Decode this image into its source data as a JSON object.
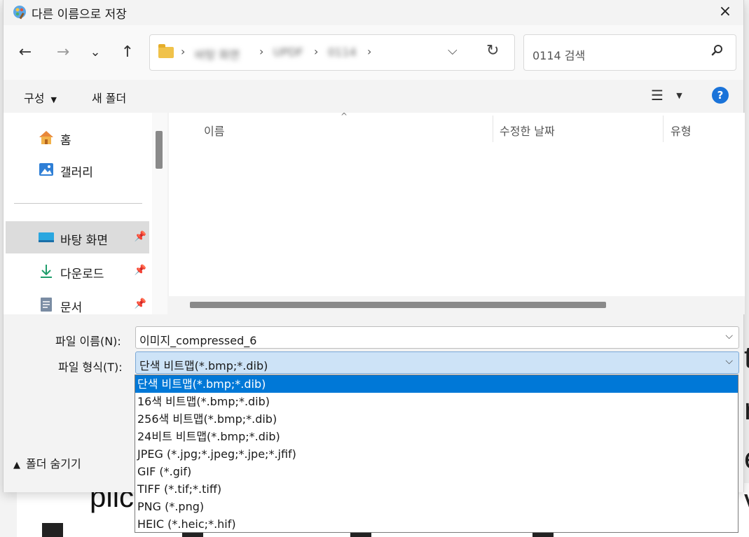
{
  "dialog": {
    "title": "다른 이름으로 저장",
    "close_icon": "×"
  },
  "nav": {
    "back": "←",
    "forward": "→",
    "recent": "⌄",
    "up": "↑"
  },
  "address": {
    "crumbs": [
      "바탕 화면",
      "UPDF",
      "0114"
    ],
    "dropdown": "⌵",
    "refresh": "↻"
  },
  "search": {
    "placeholder": "0114 검색",
    "icon": "search-icon"
  },
  "command_bar": {
    "organize_label": "구성",
    "new_folder_label": "새 폴더",
    "help_label": "?"
  },
  "sidebar": {
    "items": [
      {
        "label": "홈",
        "icon": "home-icon",
        "pinned": false
      },
      {
        "label": "갤러리",
        "icon": "gallery-icon",
        "pinned": false
      },
      {
        "label": "바탕 화면",
        "icon": "desktop-icon",
        "pinned": true,
        "selected": true
      },
      {
        "label": "다운로드",
        "icon": "download-icon",
        "pinned": true
      },
      {
        "label": "문서",
        "icon": "document-icon",
        "pinned": true
      }
    ]
  },
  "file_list": {
    "columns": [
      "이름",
      "수정한 날짜",
      "유형"
    ]
  },
  "form": {
    "filename_label": "파일 이름(N):",
    "filename_value": "이미지_compressed_6",
    "filetype_label": "파일 형식(T):",
    "filetype_value": "단색 비트맵(*.bmp;*.dib)"
  },
  "hide_folders_label": "폴더 숨기기",
  "filetype_options": [
    "단색 비트맵(*.bmp;*.dib)",
    "16색 비트맵(*.bmp;*.dib)",
    "256색 비트맵(*.bmp;*.dib)",
    "24비트 비트맵(*.bmp;*.dib)",
    "JPEG (*.jpg;*.jpeg;*.jpe;*.jfif)",
    "GIF (*.gif)",
    "TIFF (*.tif;*.tiff)",
    "PNG (*.png)",
    "HEIC (*.heic;*.hif)"
  ],
  "background": {
    "partial_word": "plic"
  }
}
